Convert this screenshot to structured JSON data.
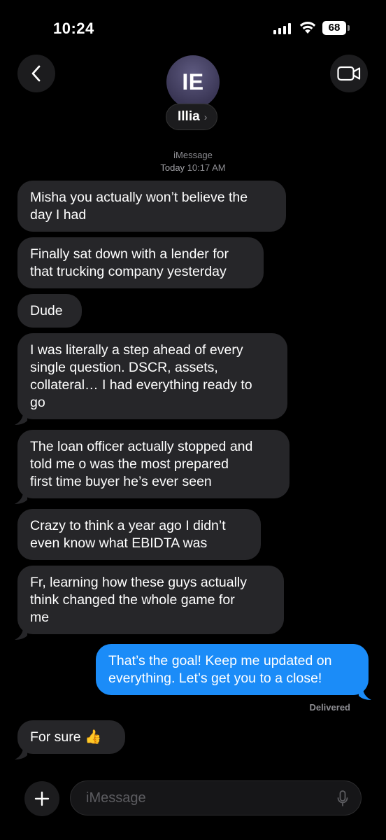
{
  "status_bar": {
    "time": "10:24",
    "battery": "68"
  },
  "contact": {
    "initials": "IE",
    "name": "Illia"
  },
  "thread": {
    "service": "iMessage",
    "timestamp_day": "Today",
    "timestamp_time": "10:17 AM",
    "delivered_label": "Delivered"
  },
  "messages": [
    {
      "direction": "incoming",
      "lines": [
        "Misha you actually won’t believe the",
        "day I had"
      ]
    },
    {
      "direction": "incoming",
      "lines": [
        "Finally sat down with a lender for",
        "that trucking company yesterday"
      ]
    },
    {
      "direction": "incoming",
      "lines": [
        "Dude"
      ]
    },
    {
      "direction": "incoming",
      "lines": [
        "I was literally a step ahead of every",
        "single question. DSCR, assets,",
        "collateral… I had everything ready to",
        "go"
      ]
    },
    {
      "direction": "incoming",
      "lines": [
        "The loan officer actually stopped and",
        "told me o was the most prepared",
        "first time buyer he’s ever seen"
      ]
    },
    {
      "direction": "incoming",
      "lines": [
        "Crazy to think a year ago I didn’t",
        "even know what EBIDTA was"
      ]
    },
    {
      "direction": "incoming",
      "lines": [
        "Fr, learning how these guys actually",
        "think changed the whole game for",
        "me"
      ]
    },
    {
      "direction": "outgoing",
      "lines": [
        "That’s the goal! Keep me updated on",
        "everything. Let’s get you to a close!"
      ]
    },
    {
      "direction": "incoming",
      "lines": [
        "For sure 👍"
      ]
    }
  ],
  "composer": {
    "placeholder": "iMessage"
  },
  "icons": {
    "back": "chevron-left-icon",
    "video": "video-camera-icon",
    "plus": "plus-icon",
    "mic": "microphone-icon"
  },
  "colors": {
    "incoming_bubble": "#262629",
    "outgoing_bubble": "#1b8cf8",
    "background": "#000000"
  }
}
